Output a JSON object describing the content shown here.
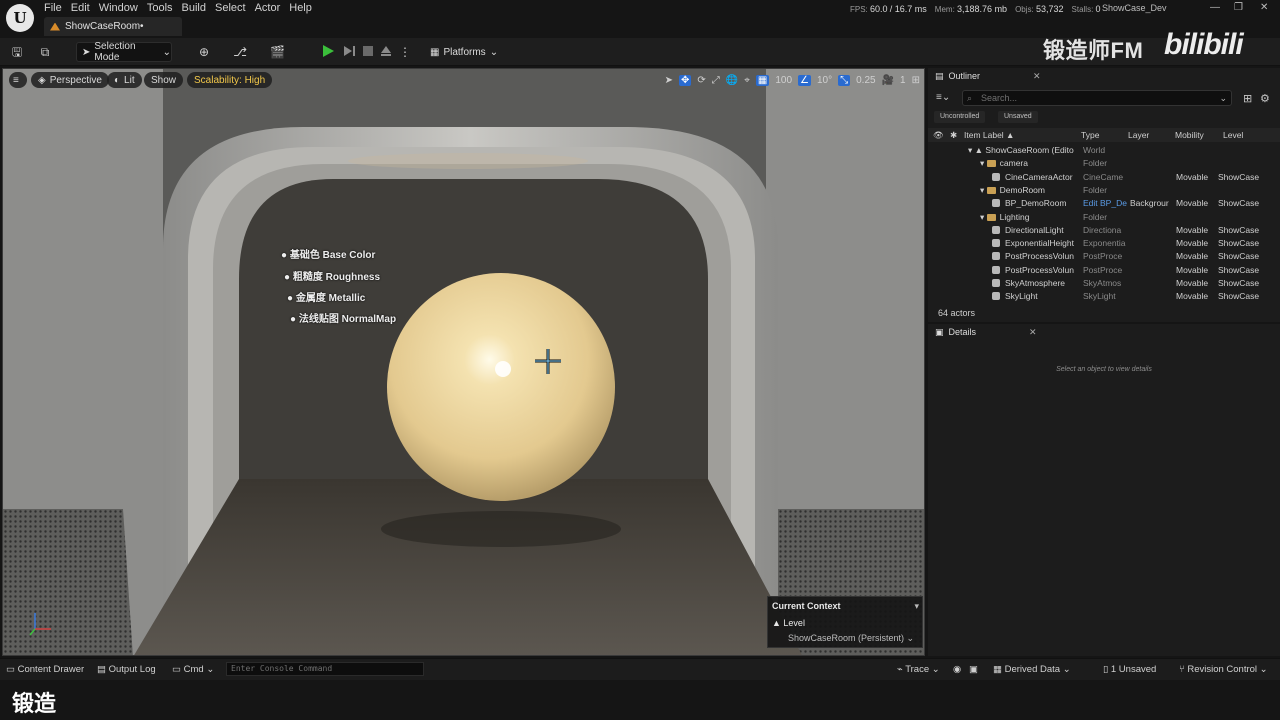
{
  "menu": {
    "items": [
      "File",
      "Edit",
      "Window",
      "Tools",
      "Build",
      "Select",
      "Actor",
      "Help"
    ],
    "level_tab": "ShowCaseRoom•"
  },
  "stats": {
    "fps_label": "FPS:",
    "fps": "60.0",
    "ms": "/ 16.7 ms",
    "mem_label": "Mem:",
    "mem": "3,188.76 mb",
    "objs_label": "Objs:",
    "objs": "53,732",
    "stalls_label": "Stalls:",
    "stalls": "0"
  },
  "project": "ShowCase_Dev",
  "watermark": {
    "text": "锻造师FM",
    "brand": "bilibili"
  },
  "toolbar": {
    "selection_mode": "Selection Mode",
    "platforms": "Platforms"
  },
  "viewport": {
    "perspective": "Perspective",
    "lit": "Lit",
    "show": "Show",
    "scalability": "Scalability: High",
    "grid_snap": "100",
    "rot_snap": "10°",
    "scale_snap": "0.25",
    "camera_speed": "1",
    "bullets": [
      "基础色 Base Color",
      "粗糙度 Roughness",
      "金属度 Metallic",
      "法线贴图 NormalMap"
    ],
    "context": {
      "title": "Current Context",
      "level": "Level",
      "persistent": "ShowCaseRoom (Persistent)"
    }
  },
  "outliner": {
    "tab": "Outliner",
    "search_placeholder": "Search...",
    "badges": [
      "Uncontrolled",
      "Unsaved"
    ],
    "columns": [
      "Item Label ▲",
      "Type",
      "Layer",
      "Mobility",
      "Level"
    ],
    "rows": [
      {
        "label": "ShowCaseRoom (Edito",
        "type": "World",
        "layer": "",
        "mobility": "",
        "level": "",
        "indent": 0,
        "kind": "world"
      },
      {
        "label": "camera",
        "type": "Folder",
        "layer": "",
        "mobility": "",
        "level": "",
        "indent": 1,
        "kind": "folder"
      },
      {
        "label": "CineCameraActor",
        "type": "CineCame",
        "layer": "",
        "mobility": "Movable",
        "level": "ShowCase",
        "indent": 2,
        "kind": "actor"
      },
      {
        "label": "DemoRoom",
        "type": "Folder",
        "layer": "",
        "mobility": "",
        "level": "",
        "indent": 1,
        "kind": "folder"
      },
      {
        "label": "BP_DemoRoom",
        "type": "Edit BP_De",
        "layer": "Backgrour",
        "mobility": "Movable",
        "level": "ShowCase",
        "indent": 2,
        "kind": "actor",
        "link": true
      },
      {
        "label": "Lighting",
        "type": "Folder",
        "layer": "",
        "mobility": "",
        "level": "",
        "indent": 1,
        "kind": "folder"
      },
      {
        "label": "DirectionalLight",
        "type": "Directiona",
        "layer": "",
        "mobility": "Movable",
        "level": "ShowCase",
        "indent": 2,
        "kind": "actor"
      },
      {
        "label": "ExponentialHeight",
        "type": "Exponentia",
        "layer": "",
        "mobility": "Movable",
        "level": "ShowCase",
        "indent": 2,
        "kind": "actor"
      },
      {
        "label": "PostProcessVolun",
        "type": "PostProce",
        "layer": "",
        "mobility": "Movable",
        "level": "ShowCase",
        "indent": 2,
        "kind": "actor"
      },
      {
        "label": "PostProcessVolun",
        "type": "PostProce",
        "layer": "",
        "mobility": "Movable",
        "level": "ShowCase",
        "indent": 2,
        "kind": "actor"
      },
      {
        "label": "SkyAtmosphere",
        "type": "SkyAtmos",
        "layer": "",
        "mobility": "Movable",
        "level": "ShowCase",
        "indent": 2,
        "kind": "actor"
      },
      {
        "label": "SkyLight",
        "type": "SkyLight",
        "layer": "",
        "mobility": "Movable",
        "level": "ShowCase",
        "indent": 2,
        "kind": "actor"
      }
    ],
    "count": "64 actors"
  },
  "details": {
    "tab": "Details",
    "empty": "Select an object to view details"
  },
  "statusbar": {
    "content_drawer": "Content Drawer",
    "output_log": "Output Log",
    "cmd": "Cmd",
    "console_placeholder": "Enter Console Command",
    "trace": "Trace",
    "derived_data": "Derived Data",
    "unsaved": "1 Unsaved",
    "revision_control": "Revision Control"
  },
  "subtitle": "锻造",
  "colors": {
    "accent_blue": "#2a6bd0",
    "play_green": "#3bbf3b",
    "scalability_yellow": "#f1c74a",
    "folder": "#c9a054"
  }
}
